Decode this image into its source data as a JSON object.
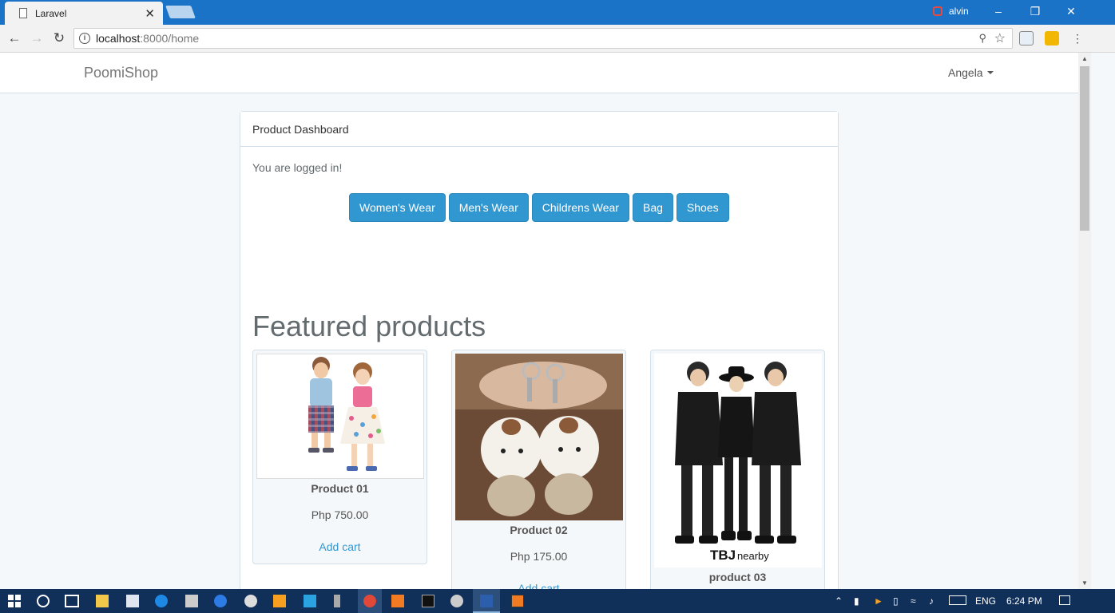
{
  "browser": {
    "tab_title": "Laravel",
    "tab_close": "✕",
    "url_host": "localhost",
    "url_path": ":8000/home",
    "user_name": "alvin"
  },
  "app": {
    "brand": "PoomiShop",
    "user": "Angela"
  },
  "panel": {
    "heading": "Product Dashboard",
    "status": "You are logged in!"
  },
  "categories": [
    "Women's Wear",
    "Men's Wear",
    "Childrens Wear",
    "Bag",
    "Shoes"
  ],
  "featured": {
    "title": "Featured products",
    "products": [
      {
        "name": "Product 01",
        "price": "Php 750.00",
        "action": "Add cart"
      },
      {
        "name": "Product 02",
        "price": "Php 175.00",
        "action": "Add cart"
      },
      {
        "name": "product 03",
        "image_text_1": "TBJ",
        "image_text_2": "nearby"
      }
    ]
  },
  "taskbar": {
    "language": "ENG",
    "time": "6:24 PM"
  },
  "colors": {
    "accent": "#3097d1",
    "titlebar": "#1a73c7",
    "taskbar": "#10305a"
  }
}
